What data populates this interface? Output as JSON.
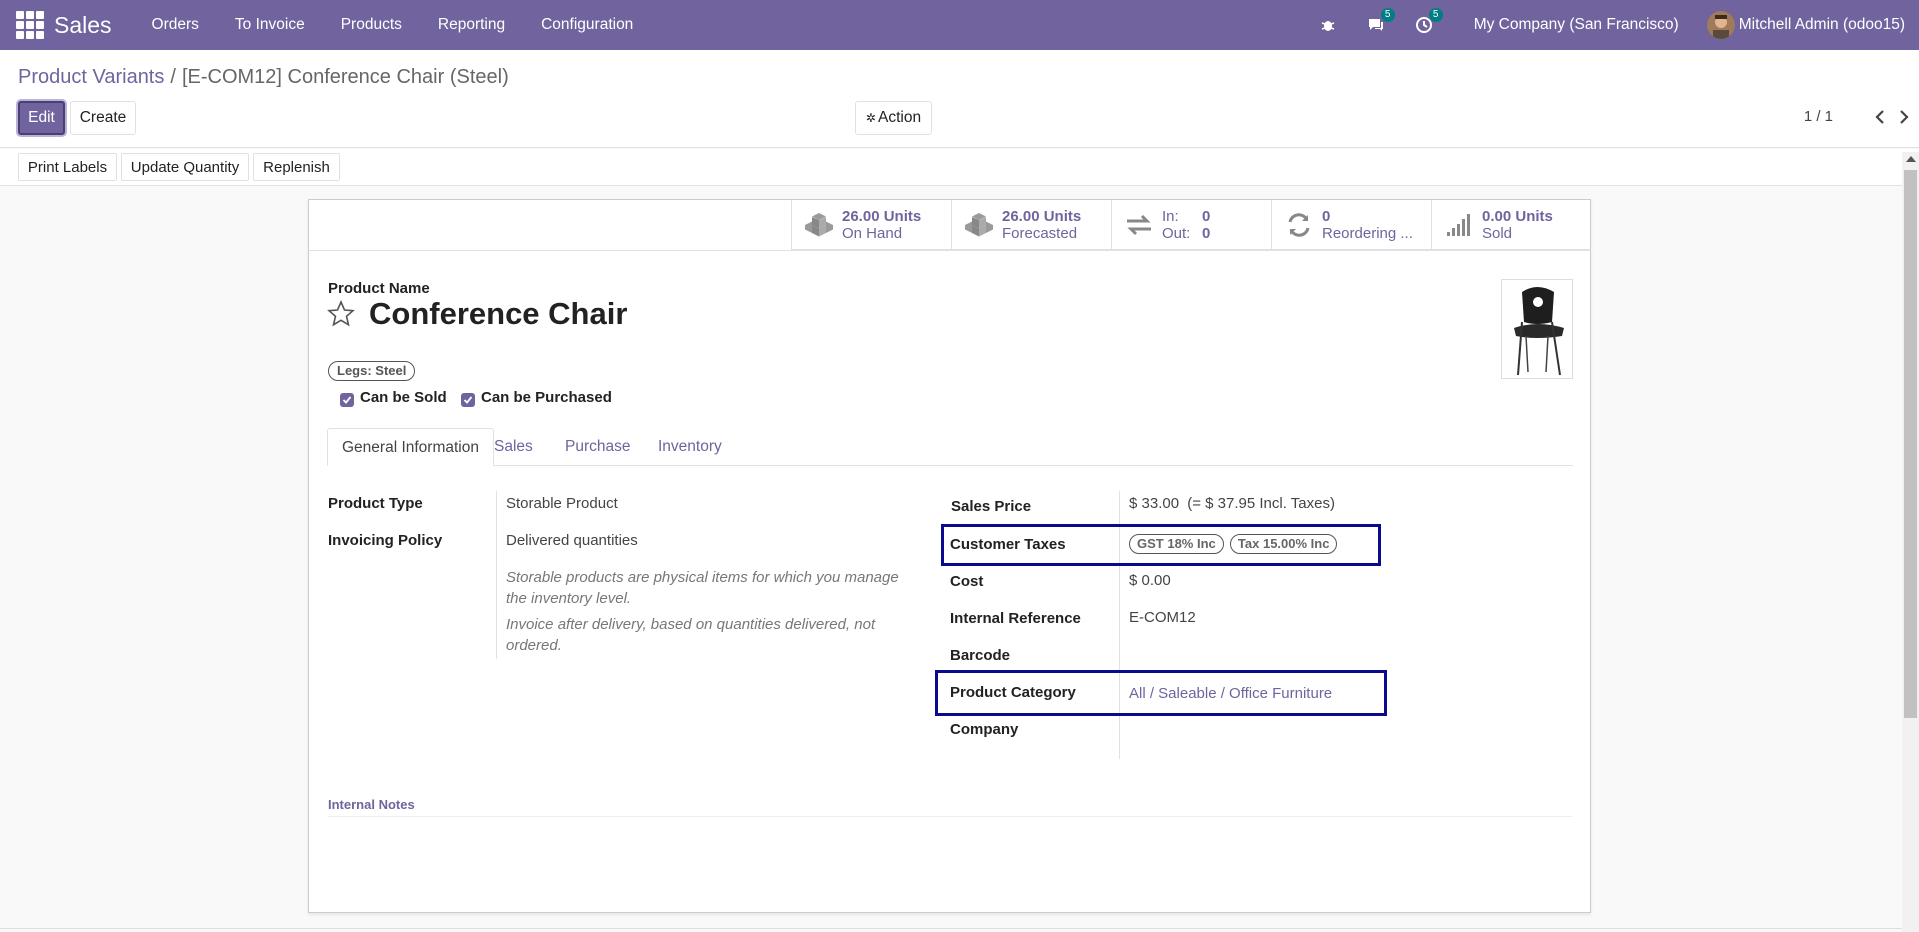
{
  "navbar": {
    "app_name": "Sales",
    "menu": [
      "Orders",
      "To Invoice",
      "Products",
      "Reporting",
      "Configuration"
    ],
    "messages_count": "5",
    "activities_count": "5",
    "company": "My Company (San Francisco)",
    "user": "Mitchell Admin (odoo15)"
  },
  "breadcrumb": {
    "parent": "Product Variants",
    "separator": "/",
    "current": "[E-COM12] Conference Chair (Steel)"
  },
  "control": {
    "edit_label": "Edit",
    "create_label": "Create",
    "action_label": "Action",
    "pager": "1 / 1"
  },
  "buttonbar": {
    "print_labels": "Print Labels",
    "update_quantity": "Update Quantity",
    "replenish": "Replenish"
  },
  "stats": {
    "on_hand_value": "26.00 Units",
    "on_hand_label": "On Hand",
    "forecasted_value": "26.00 Units",
    "forecasted_label": "Forecasted",
    "in_label": "In:",
    "in_value": "0",
    "out_label": "Out:",
    "out_value": "0",
    "reordering_value": "0",
    "reordering_label": "Reordering ...",
    "sold_value": "0.00 Units",
    "sold_label": "Sold"
  },
  "product": {
    "name_label": "Product Name",
    "name": "Conference Chair",
    "attribute_tag": "Legs: Steel",
    "can_be_sold": "Can be Sold",
    "can_be_purchased": "Can be Purchased"
  },
  "tabs": [
    "General Information",
    "Sales",
    "Purchase",
    "Inventory"
  ],
  "left_fields": {
    "product_type_label": "Product Type",
    "product_type": "Storable Product",
    "invoicing_policy_label": "Invoicing Policy",
    "invoicing_policy": "Delivered quantities",
    "help_storable": "Storable products are physical items for which you manage the inventory level.",
    "help_invoice": "Invoice after delivery, based on quantities delivered, not ordered."
  },
  "right_fields": {
    "sales_price_label": "Sales Price",
    "sales_price": "$ 33.00",
    "sales_price_incl": "(= $ 37.95 Incl. Taxes)",
    "customer_taxes_label": "Customer Taxes",
    "customer_taxes": [
      "GST 18% Inc",
      "Tax 15.00% Inc"
    ],
    "cost_label": "Cost",
    "cost": "$ 0.00",
    "internal_reference_label": "Internal Reference",
    "internal_reference": "E-COM12",
    "barcode_label": "Barcode",
    "barcode": "",
    "product_category_label": "Product Category",
    "product_category": "All / Saleable / Office Furniture",
    "company_label": "Company",
    "company": ""
  },
  "notes": {
    "internal_notes_label": "Internal Notes"
  },
  "colors": {
    "brand": "#71639e",
    "highlight_box": "#0a0a8c"
  }
}
